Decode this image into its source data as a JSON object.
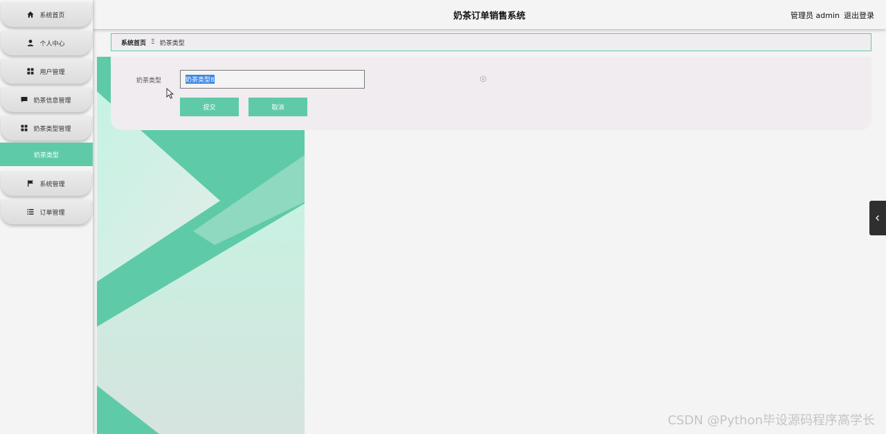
{
  "app": {
    "title": "奶茶订单销售系统"
  },
  "header": {
    "role_label": "管理员 admin",
    "logout_label": "退出登录"
  },
  "sidebar": {
    "items": [
      {
        "label": "系统首页",
        "icon": "home-icon"
      },
      {
        "label": "个人中心",
        "icon": "person-icon"
      },
      {
        "label": "用户管理",
        "icon": "grid-icon"
      },
      {
        "label": "奶茶信息管理",
        "icon": "chat-icon"
      },
      {
        "label": "奶茶类型管理",
        "icon": "grid-icon"
      },
      {
        "label": "奶茶类型",
        "icon": "",
        "active": true
      },
      {
        "label": "系统管理",
        "icon": "flag-icon"
      },
      {
        "label": "订单管理",
        "icon": "list-icon"
      }
    ]
  },
  "breadcrumb": {
    "home": "系统首页",
    "separator": "Ξ",
    "current": "奶茶类型"
  },
  "form": {
    "field_label": "奶茶类型",
    "field_value": "奶茶类型8",
    "submit_label": "提交",
    "cancel_label": "取消"
  },
  "watermark": "CSDN @Python毕设源码程序高学长",
  "colors": {
    "accent": "#5fcaa8",
    "selection": "#3b86e4",
    "sidebar_bg": "#f4f4f4"
  }
}
